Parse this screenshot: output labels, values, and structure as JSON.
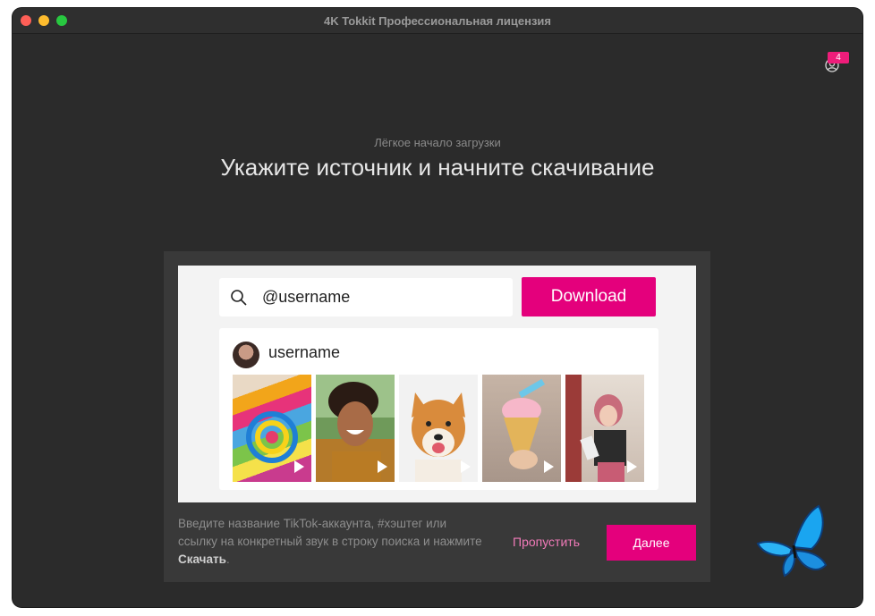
{
  "window": {
    "title": "4K Tokkit Профессиональная лицензия"
  },
  "account": {
    "icon": "account-icon",
    "badge_count": "4"
  },
  "hero": {
    "subtitle": "Лёгкое начало загрузки",
    "title": "Укажите источник и начните скачивание"
  },
  "preview": {
    "search_value": "@username",
    "download_label": "Download",
    "result_username": "username",
    "thumbnails": [
      {
        "name": "rainbow-art-thumbnail"
      },
      {
        "name": "smiling-person-thumbnail"
      },
      {
        "name": "shiba-dog-thumbnail"
      },
      {
        "name": "ice-cream-thumbnail"
      },
      {
        "name": "dancing-girl-thumbnail"
      }
    ]
  },
  "hint": {
    "text_before": "Введите название TikTok-аккаунта, #хэштег или ссылку на конкретный звук в строку поиска и нажмите ",
    "bold": "Скачать",
    "text_after": "."
  },
  "actions": {
    "skip_label": "Пропустить",
    "next_label": "Далее"
  },
  "colors": {
    "accent": "#e4007c",
    "window_bg": "#2b2b2b",
    "card_bg": "#393939"
  }
}
